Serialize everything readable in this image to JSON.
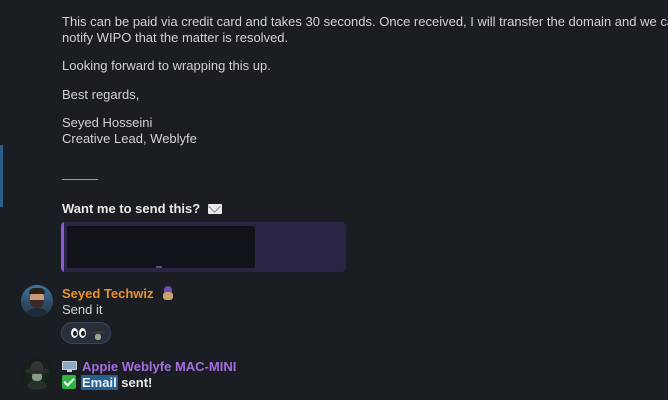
{
  "message_body": {
    "line_1": "This can be paid via credit card and takes 30 seconds. Once received, I will transfer the domain and we can",
    "line_2": "notify WIPO that the matter is resolved.",
    "line_3": "Looking forward to wrapping this up.",
    "line_4": "Best regards,",
    "line_5": "Seyed Hosseini",
    "line_6": "Creative Lead, Weblyfe"
  },
  "question": {
    "text": "Want me to send this?",
    "icon": "envelope-icon"
  },
  "messages": [
    {
      "author": "Seyed Techwiz",
      "author_color": "#e8912d",
      "author_icon": "wizard-sticker-icon",
      "text": "Send it",
      "reactions": [
        "eyes-emoji",
        "wizard-emoji"
      ]
    },
    {
      "author": "Appie Weblyfe MAC-MINI",
      "author_color": "#a56ee0",
      "author_icon": "monitor-icon",
      "text_highlight": "Email",
      "text_rest": " sent!",
      "status_icon": "check-mark-icon",
      "status_color": "#2fb344"
    }
  ],
  "colors": {
    "background": "#1a1d21",
    "quote_accent": "#8c5ad6",
    "selection_highlight": "#27608f"
  }
}
